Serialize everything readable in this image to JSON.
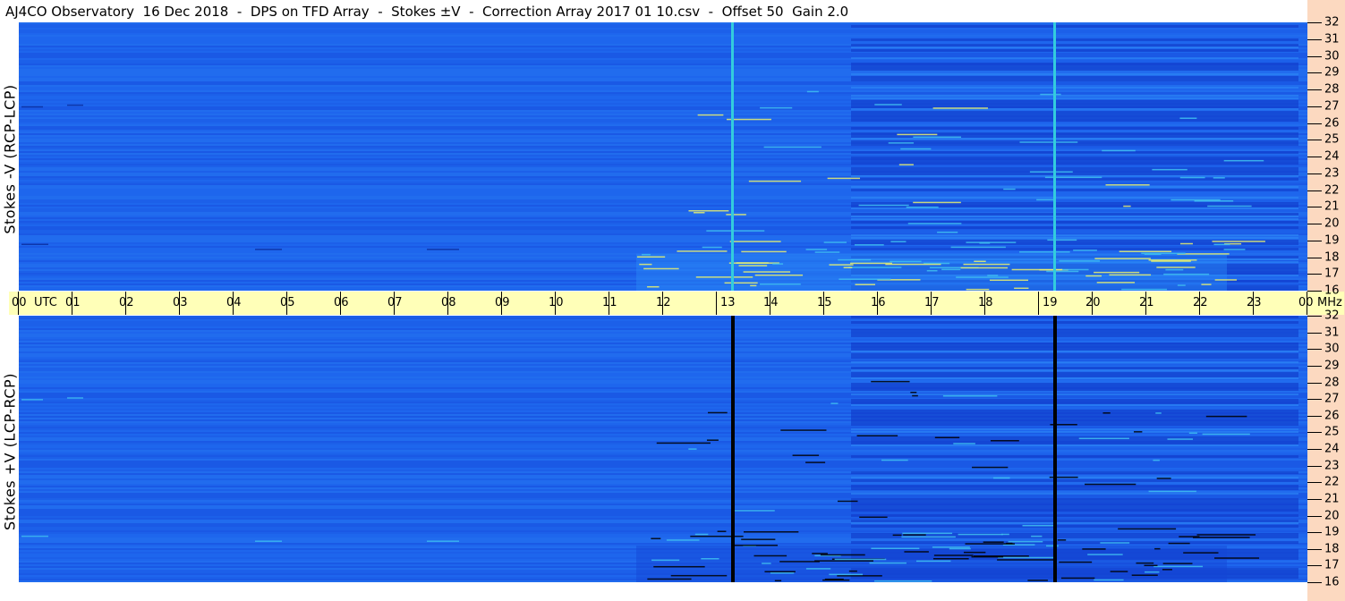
{
  "header": {
    "title": "AJ4CO Observatory  16 Dec 2018  -  DPS on TFD Array  -  Stokes ±V  -  Correction Array 2017 01 10.csv  -  Offset 50  Gain 2.0"
  },
  "chart_data": [
    {
      "type": "heatmap",
      "ylabel": "Stokes -V (RCP-LCP)",
      "x_unit": "UTC",
      "y_unit": "MHz",
      "xlim": [
        0,
        24
      ],
      "ylim": [
        16,
        32
      ],
      "x_ticks": [
        "00",
        "01",
        "02",
        "03",
        "04",
        "05",
        "06",
        "07",
        "08",
        "09",
        "10",
        "11",
        "12",
        "13",
        "14",
        "15",
        "16",
        "17",
        "18",
        "19",
        "20",
        "21",
        "22",
        "23",
        "00"
      ],
      "y_ticks": [
        "16",
        "17",
        "18",
        "19",
        "20",
        "21",
        "22",
        "23",
        "24",
        "25",
        "26",
        "27",
        "28",
        "29",
        "30",
        "31",
        "32"
      ],
      "vertical_lines_utc": [
        13.3,
        19.3
      ],
      "line_color": "#33ccdd",
      "colormap": [
        "#0a2a9a",
        "#1040e0",
        "#1f6cf5",
        "#2a85f5",
        "#40c0f0",
        "#e8f070"
      ]
    },
    {
      "type": "heatmap",
      "ylabel": "Stokes +V (LCP-RCP)",
      "x_unit": "UTC",
      "y_unit": "MHz",
      "xlim": [
        0,
        24
      ],
      "ylim": [
        16,
        32
      ],
      "x_ticks": [
        "00",
        "01",
        "02",
        "03",
        "04",
        "05",
        "06",
        "07",
        "08",
        "09",
        "10",
        "11",
        "12",
        "13",
        "14",
        "15",
        "16",
        "17",
        "18",
        "19",
        "20",
        "21",
        "22",
        "23",
        "00"
      ],
      "y_ticks": [
        "16",
        "17",
        "18",
        "19",
        "20",
        "21",
        "22",
        "23",
        "24",
        "25",
        "26",
        "27",
        "28",
        "29",
        "30",
        "31",
        "32"
      ],
      "vertical_lines_utc": [
        13.3,
        19.3
      ],
      "line_color": "#000000",
      "colormap": [
        "#000000",
        "#0a2a9a",
        "#1040e0",
        "#1f6cf5",
        "#2a85f5",
        "#40c0f0"
      ]
    }
  ],
  "axis": {
    "utc_label": "UTC",
    "mhz_label": "MHz"
  },
  "colors": {
    "time_bar": "#ffffb8",
    "freq_strip": "#fcd9c0",
    "background": "#ffffff"
  }
}
